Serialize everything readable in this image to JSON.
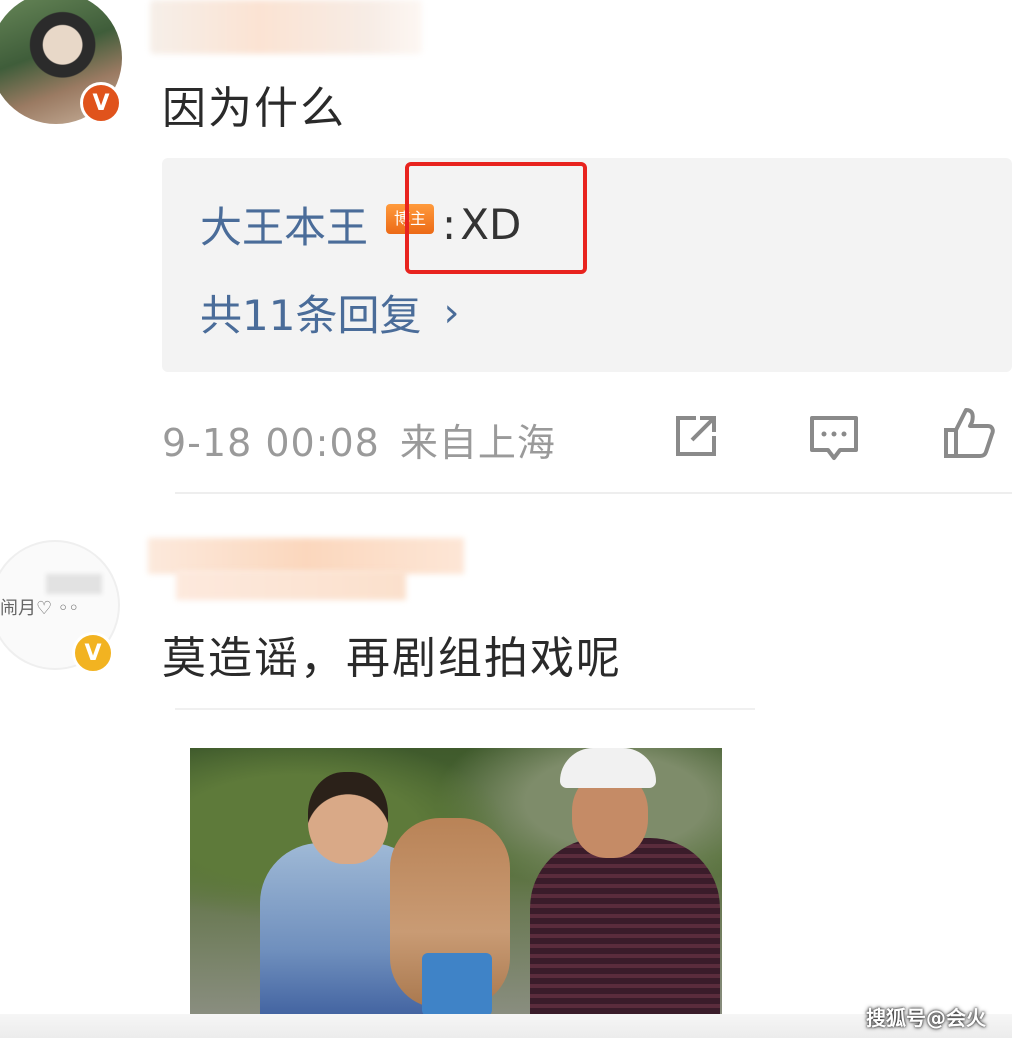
{
  "comment1": {
    "text": "因为什么",
    "reply": {
      "author": "大王本王",
      "badge": "博主",
      "colon": ":",
      "text": "XD",
      "count_label": "共11条回复",
      "chevron": "›"
    },
    "meta": {
      "time": "9-18 00:08",
      "location": "来自上海"
    },
    "actions": [
      "share-icon",
      "comment-icon",
      "like-icon"
    ]
  },
  "comment2": {
    "avatar_text": "闹月♡ ◦◦",
    "text": "莫造谣，再剧组拍戏呢"
  },
  "watermark": "搜狐号@会火",
  "colors": {
    "link_blue": "#4a6c99",
    "badge_orange": "#ec6a16",
    "highlight_red": "#e8231e",
    "verified_red": "#e0531c",
    "verified_gold": "#f2b321",
    "meta_gray": "#9a9a9a"
  }
}
